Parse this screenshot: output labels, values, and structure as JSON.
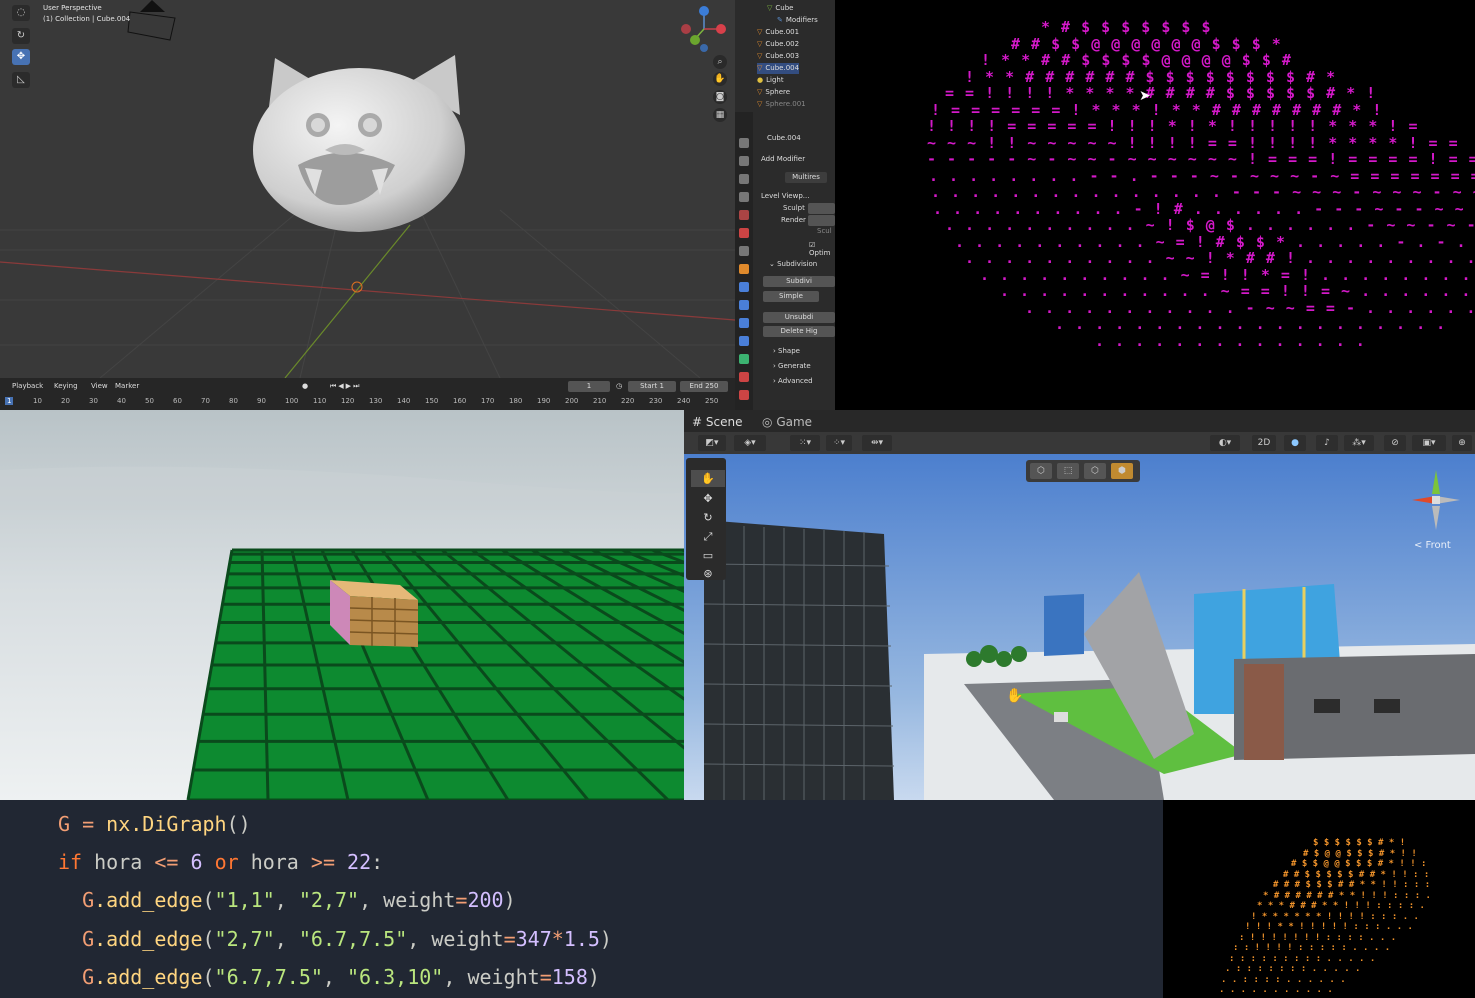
{
  "blender": {
    "viewport": {
      "perspective_label": "User Perspective",
      "collection_label": "(1) Collection | Cube.004"
    },
    "outliner": {
      "items": [
        {
          "label": "Cube",
          "type": "mesh"
        },
        {
          "label": "Modifiers",
          "type": "modifier"
        },
        {
          "label": "Cube.001",
          "type": "mesh"
        },
        {
          "label": "Cube.002",
          "type": "mesh"
        },
        {
          "label": "Cube.003",
          "type": "mesh"
        },
        {
          "label": "Cube.004",
          "type": "mesh"
        },
        {
          "label": "Light",
          "type": "light"
        },
        {
          "label": "Sphere",
          "type": "mesh"
        },
        {
          "label": "Sphere.001",
          "type": "mesh"
        }
      ]
    },
    "properties": {
      "object_name": "Cube.004",
      "add_modifier": "Add Modifier",
      "modifier_name": "Multires",
      "level_viewport": "Level Viewp...",
      "sculpt": "Sculpt",
      "render": "Render",
      "sculpt_check": "Scul",
      "optimal": "Optim",
      "subdivision": "Subdivision",
      "subdivide": "Subdivi",
      "simple": "Simple",
      "unsubdivide": "Unsubdi",
      "delete_higher": "Delete Hig",
      "shape": "Shape",
      "generate": "Generate",
      "advanced": "Advanced"
    },
    "timeline": {
      "menus": [
        "Playback",
        "Keying",
        "View",
        "Marker"
      ],
      "current_frame": "1",
      "start_label": "Start",
      "start_value": "1",
      "end_label": "End",
      "end_value": "250",
      "ticks": [
        "1",
        "10",
        "20",
        "30",
        "40",
        "50",
        "60",
        "70",
        "80",
        "90",
        "100",
        "110",
        "120",
        "130",
        "140",
        "150",
        "160",
        "170",
        "180",
        "190",
        "200",
        "210",
        "220",
        "230",
        "240",
        "250"
      ]
    }
  },
  "unity": {
    "tabs": [
      {
        "label": "Scene",
        "icon": "hash-icon"
      },
      {
        "label": "Game",
        "icon": "gamepad-icon"
      }
    ],
    "mode_2d": "2D",
    "gizmo_label": "< Front"
  },
  "code": {
    "lines": [
      [
        {
          "t": "G",
          "c": "c-var"
        },
        {
          "t": " = ",
          "c": "c-op"
        },
        {
          "t": "nx.DiGraph",
          "c": "c-fn"
        },
        {
          "t": "()",
          "c": "c-id"
        }
      ],
      [
        {
          "t": "if ",
          "c": "c-kw"
        },
        {
          "t": "hora ",
          "c": "c-id"
        },
        {
          "t": "<= ",
          "c": "c-op"
        },
        {
          "t": "6 ",
          "c": "c-num"
        },
        {
          "t": "or ",
          "c": "c-kw"
        },
        {
          "t": "hora ",
          "c": "c-id"
        },
        {
          "t": ">= ",
          "c": "c-op"
        },
        {
          "t": "22",
          "c": "c-num"
        },
        {
          "t": ":",
          "c": "c-id"
        }
      ],
      [
        {
          "t": "  G",
          "c": "c-var"
        },
        {
          "t": ".add_edge",
          "c": "c-fn"
        },
        {
          "t": "(",
          "c": "c-id"
        },
        {
          "t": "\"1,1\"",
          "c": "c-str"
        },
        {
          "t": ", ",
          "c": "c-id"
        },
        {
          "t": "\"2,7\"",
          "c": "c-str"
        },
        {
          "t": ", ",
          "c": "c-id"
        },
        {
          "t": "weight",
          "c": "c-id"
        },
        {
          "t": "=",
          "c": "c-op"
        },
        {
          "t": "200",
          "c": "c-num"
        },
        {
          "t": ")",
          "c": "c-id"
        }
      ],
      [
        {
          "t": "  G",
          "c": "c-var"
        },
        {
          "t": ".add_edge",
          "c": "c-fn"
        },
        {
          "t": "(",
          "c": "c-id"
        },
        {
          "t": "\"2,7\"",
          "c": "c-str"
        },
        {
          "t": ", ",
          "c": "c-id"
        },
        {
          "t": "\"6.7,7.5\"",
          "c": "c-str"
        },
        {
          "t": ", ",
          "c": "c-id"
        },
        {
          "t": "weight",
          "c": "c-id"
        },
        {
          "t": "=",
          "c": "c-op"
        },
        {
          "t": "347",
          "c": "c-num"
        },
        {
          "t": "*",
          "c": "c-op"
        },
        {
          "t": "1.5",
          "c": "c-num"
        },
        {
          "t": ")",
          "c": "c-id"
        }
      ],
      [
        {
          "t": "  G",
          "c": "c-var"
        },
        {
          "t": ".add_edge",
          "c": "c-fn"
        },
        {
          "t": "(",
          "c": "c-id"
        },
        {
          "t": "\"6.7,7.5\"",
          "c": "c-str"
        },
        {
          "t": ", ",
          "c": "c-id"
        },
        {
          "t": "\"6.3,10\"",
          "c": "c-str"
        },
        {
          "t": ", ",
          "c": "c-id"
        },
        {
          "t": "weight",
          "c": "c-id"
        },
        {
          "t": "=",
          "c": "c-op"
        },
        {
          "t": "158",
          "c": "c-num"
        },
        {
          "t": ")",
          "c": "c-id"
        }
      ]
    ]
  },
  "ascii_art": {
    "magenta_color": "#d419c9",
    "magenta_rows": [
      "* # $ $ $ $ $ $ $",
      "# # $ $ @ @ @ @ @ @ $ $ $ *",
      "! * * # # $ $ $ $ @ @ @ @ $ $ #",
      "! * * # # # # # # $ $ $ $ $ $ $ $ # *",
      "= = ! ! ! ! * * * * # # # # $ $ $ $ $ # * !",
      "! = = = = = = ! * * * ! * * # # # # # # # * !",
      "! ! ! ! = = = = = ! ! ! * ! * ! ! ! ! ! * * * ! =",
      "~ ~ ~ ! ! ~ ~ ~ ~ ~ ! ! ! ! = = ! ! ! ! * * * * ! = =",
      "- - - - - ~ - ~ ~ - ~ ~ ~ ~ ~ ~ ! = = = ! = = = = ! = =",
      ". . . . . . . . - - . - - - ~ - ~ ~ ~ - ~ = = = = = = = !",
      ". . . . . . . . . . . . . . . - - - ~ ~ ~ - ~ ~ ~ - ~ ~ -",
      ". . . . . . . . . . - ! # . . . . . . - - - ~ - - ~ ~",
      ". . . . . . . . . . ~ ! $ @ $ . . . . . . - ~ ~ - ~ - .",
      ". . . . . . . . . . ~ = ! # $ $ * . . . . . - . - . .",
      ". . . . . . . . . . ~ ~ ! * # # ! . . . . . . . . .",
      ". . . . . . . . . . ~ = ! ! * = ! . . . . . . . .",
      ". . . . . . . . . . . ~ = = ! ! = ~ . . . . . . .",
      ". . . . . . . . . . . - ~ ~ = = - . . . . . .",
      ". . . . . . . . . . . . . . . . . . . .",
      ". . . . . . . . . . . . . ."
    ],
    "orange_color": "#f0932b",
    "orange_rows": [
      "$ $ $ $ $ $ # * !",
      "# $ @ @ $ $ $ # * ! !",
      "# $ $ @ @ $ $ $ # * ! ! :",
      "# # $ $ $ $ $ # # * ! ! : :",
      "# # # $ $ $ # # * * ! ! : : :",
      "* # # # # # # * * ! ! ! : : : .",
      "* * * # # # * * ! ! ! : : : : .",
      "! * * * * * * ! ! ! ! : : : . .",
      "! ! ! * * ! ! ! ! ! : : : . . .",
      ": ! ! ! ! ! ! ! : : : : . . .",
      ": : ! ! ! ! : : : : : . . . .",
      ": : : : : : : : : . . . . .",
      ". : : : : : : : . . . . .",
      ". . : : : : . . . . . .",
      ". . . . . . . . . . ."
    ]
  }
}
